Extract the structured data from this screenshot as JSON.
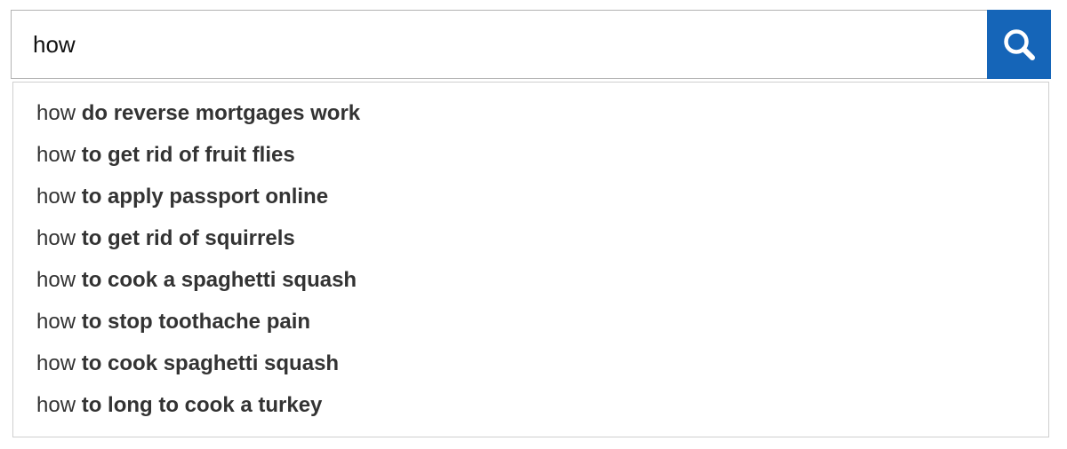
{
  "search": {
    "value": "how",
    "button_label": "Search"
  },
  "suggestions": [
    {
      "typed": "how",
      "completion": "do reverse mortgages work"
    },
    {
      "typed": "how",
      "completion": "to get rid of fruit flies"
    },
    {
      "typed": "how",
      "completion": "to apply passport online"
    },
    {
      "typed": "how",
      "completion": "to get rid of squirrels"
    },
    {
      "typed": "how",
      "completion": "to cook a spaghetti squash"
    },
    {
      "typed": "how",
      "completion": "to stop toothache pain"
    },
    {
      "typed": "how",
      "completion": "to cook spaghetti squash"
    },
    {
      "typed": "how",
      "completion": "to long to cook a turkey"
    }
  ],
  "colors": {
    "accent": "#1565b8",
    "suggestion_text": "#333333",
    "border": "#b3b3b3"
  },
  "icons": {
    "search_button": "magnifier-icon"
  }
}
